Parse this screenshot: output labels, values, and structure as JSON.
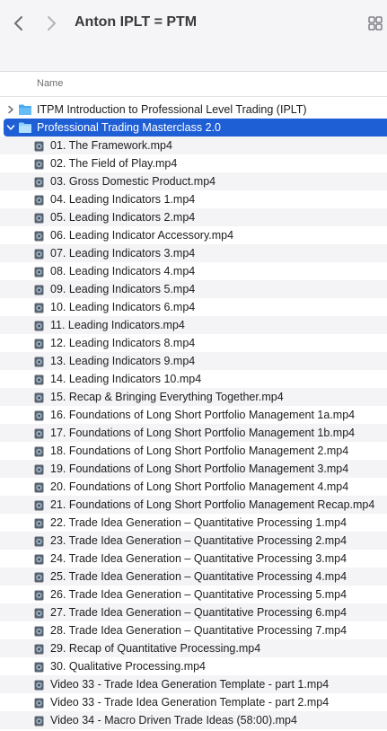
{
  "window": {
    "title": "Anton IPLT = PTM"
  },
  "header": {
    "name_column": "Name"
  },
  "folders": [
    {
      "label": "ITPM Introduction to Professional Level Trading (IPLT)",
      "expanded": false,
      "selected": false
    },
    {
      "label": "Professional Trading Masterclass 2.0",
      "expanded": true,
      "selected": true
    }
  ],
  "files": [
    "01. The Framework.mp4",
    "02. The Field of Play.mp4",
    "03. Gross Domestic Product.mp4",
    "04. Leading Indicators 1.mp4",
    "05. Leading Indicators 2.mp4",
    "06. Leading Indicator Accessory.mp4",
    "07. Leading Indicators 3.mp4",
    "08. Leading Indicators 4.mp4",
    "09. Leading Indicators 5.mp4",
    "10. Leading Indicators 6.mp4",
    "11. Leading Indicators.mp4",
    "12. Leading Indicators 8.mp4",
    "13. Leading Indicators 9.mp4",
    "14. Leading Indicators 10.mp4",
    "15. Recap & Bringing Everything Together.mp4",
    "16. Foundations of Long  Short Portfolio Management 1a.mp4",
    "17. Foundations of Long  Short Portfolio Management 1b.mp4",
    "18. Foundations of Long  Short Portfolio Management 2.mp4",
    "19. Foundations of Long  Short Portfolio Management 3.mp4",
    "20. Foundations of Long  Short Portfolio Management 4.mp4",
    "21. Foundations of Long  Short Portfolio Management Recap.mp4",
    "22. Trade Idea Generation – Quantitative Processing 1.mp4",
    "23. Trade Idea Generation – Quantitative Processing 2.mp4",
    "24. Trade Idea Generation – Quantitative Processing 3.mp4",
    "25. Trade Idea Generation – Quantitative Processing 4.mp4",
    "26. Trade Idea Generation – Quantitative Processing 5.mp4",
    "27. Trade Idea Generation – Quantitative Processing 6.mp4",
    "28. Trade Idea Generation – Quantitative Processing 7.mp4",
    "29. Recap of Quantitative Processing.mp4",
    "30. Qualitative Processing.mp4",
    "Video 33 - Trade Idea Generation Template - part 1.mp4",
    "Video 33 - Trade Idea Generation Template - part 2.mp4",
    "Video 34 - Macro Driven Trade Ideas (58:00).mp4"
  ],
  "icons": {
    "back": "chevron-left-icon",
    "forward": "chevron-right-icon",
    "view": "grid-view-icon",
    "folder": "folder-icon",
    "file": "video-file-icon"
  },
  "colors": {
    "selection": "#1f5fd6",
    "folder": "#4aa8f0",
    "toolbar": "#f5f4f7"
  }
}
